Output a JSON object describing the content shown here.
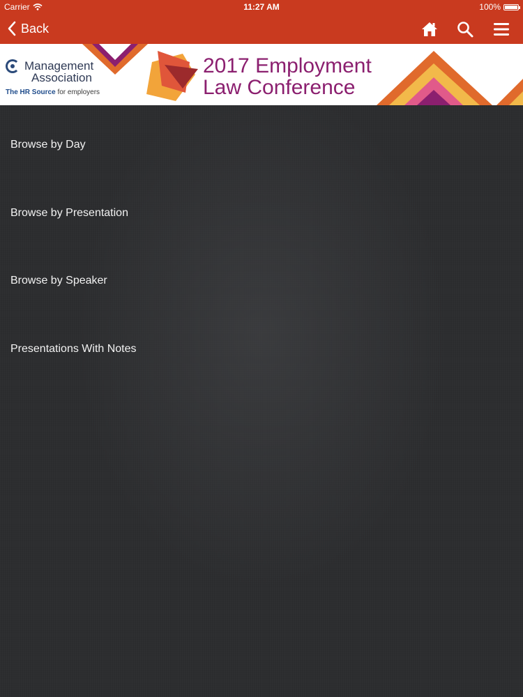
{
  "status_bar": {
    "carrier": "Carrier",
    "time": "11:27 AM",
    "battery": "100%",
    "battery_level": 1.0
  },
  "nav": {
    "back_label": "Back",
    "icons": [
      "home-icon",
      "search-icon",
      "menu-icon"
    ],
    "color": "#c93a1f"
  },
  "banner": {
    "logo_line1": "Management",
    "logo_line2": "Association",
    "logo_tagline_bold": "The HR Source",
    "logo_tagline_rest": " for employers",
    "conference_line1": "2017 Employment",
    "conference_line2": "Law Conference",
    "title_color": "#8b1f6f"
  },
  "menu": {
    "items": [
      {
        "label": "Browse by Day"
      },
      {
        "label": "Browse by Presentation"
      },
      {
        "label": "Browse by Speaker"
      },
      {
        "label": "Presentations With Notes"
      }
    ]
  }
}
